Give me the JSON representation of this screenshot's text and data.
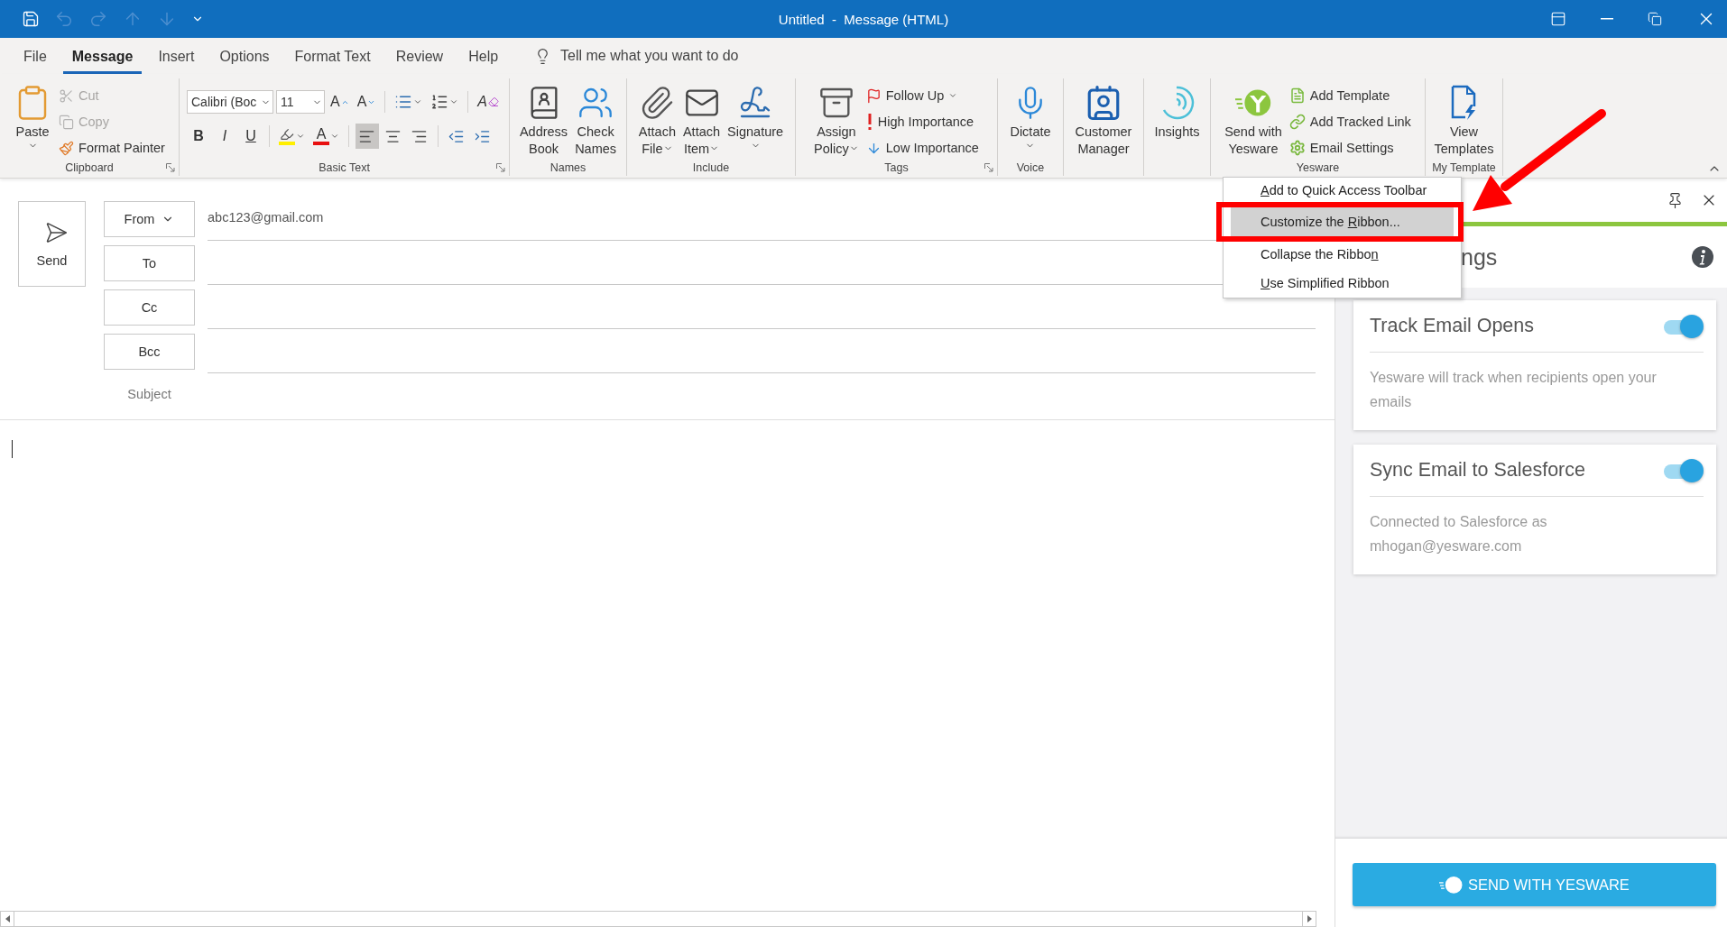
{
  "window": {
    "title": "Untitled  -  Message (HTML)"
  },
  "tabs": [
    {
      "label": "File",
      "selected": false
    },
    {
      "label": "Message",
      "selected": true
    },
    {
      "label": "Insert",
      "selected": false
    },
    {
      "label": "Options",
      "selected": false
    },
    {
      "label": "Format Text",
      "selected": false
    },
    {
      "label": "Review",
      "selected": false
    },
    {
      "label": "Help",
      "selected": false
    }
  ],
  "tell_me": {
    "placeholder": "Tell me what you want to do"
  },
  "ribbon": {
    "groups": [
      {
        "kind": "standard",
        "label": "Clipboard",
        "launcher": true,
        "columns": [
          {
            "kind": "large",
            "label": "Paste",
            "dropdown": true
          },
          {
            "kind": "stack",
            "items": [
              {
                "label": "Cut",
                "disabled": true,
                "dropdown": false
              },
              {
                "label": "Copy",
                "disabled": true,
                "dropdown": false
              },
              {
                "label": "Format Painter",
                "disabled": false,
                "dropdown": false
              }
            ]
          }
        ]
      },
      {
        "kind": "formatting",
        "label": "Basic Text",
        "launcher": true,
        "font": {
          "value": "Calibri (Boc"
        },
        "size": {
          "value": "11"
        },
        "grow": "A",
        "shrink": "A",
        "styles": [
          "B",
          "I",
          "U"
        ],
        "font_color": "A",
        "clear": "A",
        "alignment": [
          {
            "selected": true
          },
          {
            "selected": false
          },
          {
            "selected": false
          }
        ]
      },
      {
        "kind": "standard",
        "label": "Names",
        "launcher": false,
        "columns": [
          {
            "kind": "large",
            "label": "Address\nBook",
            "dropdown": false
          },
          {
            "kind": "large",
            "label": "Check\nNames",
            "dropdown": false
          }
        ]
      },
      {
        "kind": "standard",
        "label": "Include",
        "launcher": false,
        "columns": [
          {
            "kind": "large",
            "label": "Attach\nFile",
            "dropdown": true
          },
          {
            "kind": "large",
            "label": "Attach\nItem",
            "dropdown": true
          },
          {
            "kind": "large",
            "label": "Signature",
            "dropdown": true
          }
        ]
      },
      {
        "kind": "standard",
        "label": "Tags",
        "launcher": true,
        "columns": [
          {
            "kind": "large",
            "label": "Assign\nPolicy",
            "dropdown": true
          },
          {
            "kind": "stack",
            "items": [
              {
                "label": "Follow Up",
                "disabled": false,
                "dropdown": true
              },
              {
                "label": "High Importance",
                "disabled": false,
                "dropdown": false
              },
              {
                "label": "Low Importance",
                "disabled": false,
                "dropdown": false
              }
            ]
          }
        ]
      },
      {
        "kind": "standard",
        "label": "Voice",
        "launcher": false,
        "columns": [
          {
            "kind": "large",
            "label": "Dictate",
            "dropdown": true
          }
        ]
      },
      {
        "kind": "standard",
        "launcher": false,
        "columns": [
          {
            "kind": "large",
            "label": "Customer\nManager",
            "dropdown": false
          }
        ]
      },
      {
        "kind": "standard",
        "launcher": false,
        "columns": [
          {
            "kind": "large",
            "label": "Insights",
            "dropdown": false
          }
        ]
      },
      {
        "kind": "standard",
        "label": "Yesware",
        "launcher": false,
        "columns": [
          {
            "kind": "large",
            "label": "Send with\nYesware",
            "dropdown": false
          },
          {
            "kind": "stack",
            "items": [
              {
                "label": "Add Template",
                "disabled": false,
                "dropdown": false
              },
              {
                "label": "Add Tracked Link",
                "disabled": false,
                "dropdown": false
              },
              {
                "label": "Email Settings",
                "disabled": false,
                "dropdown": false
              }
            ]
          }
        ]
      },
      {
        "kind": "standard",
        "label": "My Template",
        "launcher": false,
        "columns": [
          {
            "kind": "large",
            "label": "View\nTemplates",
            "dropdown": false
          }
        ]
      }
    ]
  },
  "compose": {
    "send_button": "Send",
    "from": {
      "label": "From",
      "value": "abc123@gmail.com"
    },
    "recipients": [
      {
        "label": "To"
      },
      {
        "label": "Cc"
      },
      {
        "label": "Bcc"
      }
    ],
    "subject": {
      "label": "Subject"
    }
  },
  "pane": {
    "title": "ngs",
    "settings": [
      {
        "title": "Track Email Opens",
        "description": "Yesware will track when recipients open your emails",
        "on": true
      },
      {
        "title": "Sync Email to Salesforce",
        "description": "Connected to Salesforce as mhogan@yesware.com",
        "on": true
      }
    ],
    "send_button": "SEND WITH YESWARE"
  },
  "context_menu": {
    "items": [
      {
        "key": "A",
        "after": "dd to Quick Access Toolbar",
        "selected": false
      },
      {
        "before": "Customize the ",
        "key": "R",
        "after": "ibbon...",
        "selected": true
      },
      {
        "before": "Collapse the Ribbo",
        "key": "n",
        "selected": false
      },
      {
        "key": "U",
        "after": "se Simplified Ribbon",
        "selected": false
      }
    ]
  }
}
